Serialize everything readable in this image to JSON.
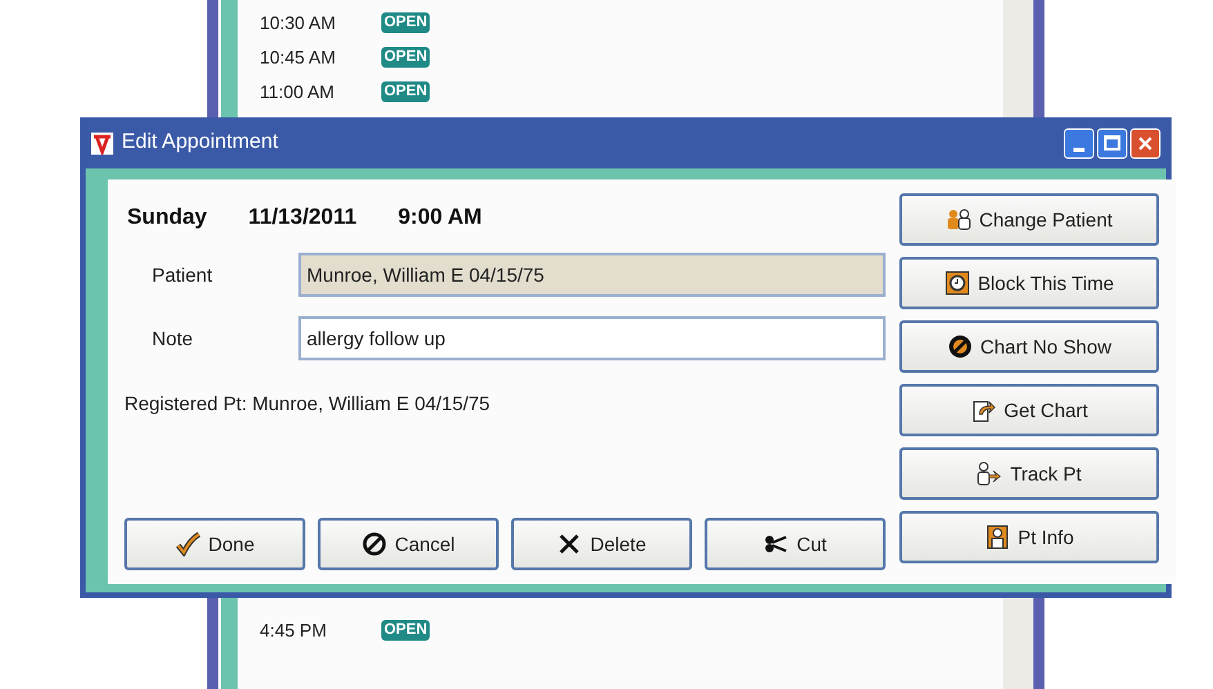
{
  "schedule": {
    "top_slots": [
      {
        "time": "10:30 AM",
        "status": "OPEN"
      },
      {
        "time": "10:45 AM",
        "status": "OPEN"
      },
      {
        "time": "11:00 AM",
        "status": "OPEN"
      }
    ],
    "bottom_slots": [
      {
        "time": "4:45 PM",
        "status": "OPEN"
      }
    ]
  },
  "dialog": {
    "title": "Edit Appointment",
    "day": "Sunday",
    "date": "11/13/2011",
    "time": "9:00 AM",
    "fields": [
      {
        "label": "Patient",
        "value": "Munroe, William E 04/15/75",
        "readonly": true
      },
      {
        "label": "Note",
        "value": "allergy follow up",
        "readonly": false
      }
    ],
    "registered": "Registered Pt: Munroe, William E 04/15/75",
    "side_buttons": [
      {
        "label": "Change Patient",
        "kind": "people"
      },
      {
        "label": "Block This Time",
        "kind": "clock"
      },
      {
        "label": "Chart No Show",
        "kind": "noshow"
      },
      {
        "label": "Get Chart",
        "kind": "chart"
      },
      {
        "label": "Track Pt",
        "kind": "track"
      },
      {
        "label": "Pt Info",
        "kind": "info"
      }
    ],
    "bottom_buttons": [
      {
        "label": "Done",
        "kind": "check"
      },
      {
        "label": "Cancel",
        "kind": "cancel"
      },
      {
        "label": "Delete",
        "kind": "x"
      },
      {
        "label": "Cut",
        "kind": "scissors"
      }
    ]
  }
}
